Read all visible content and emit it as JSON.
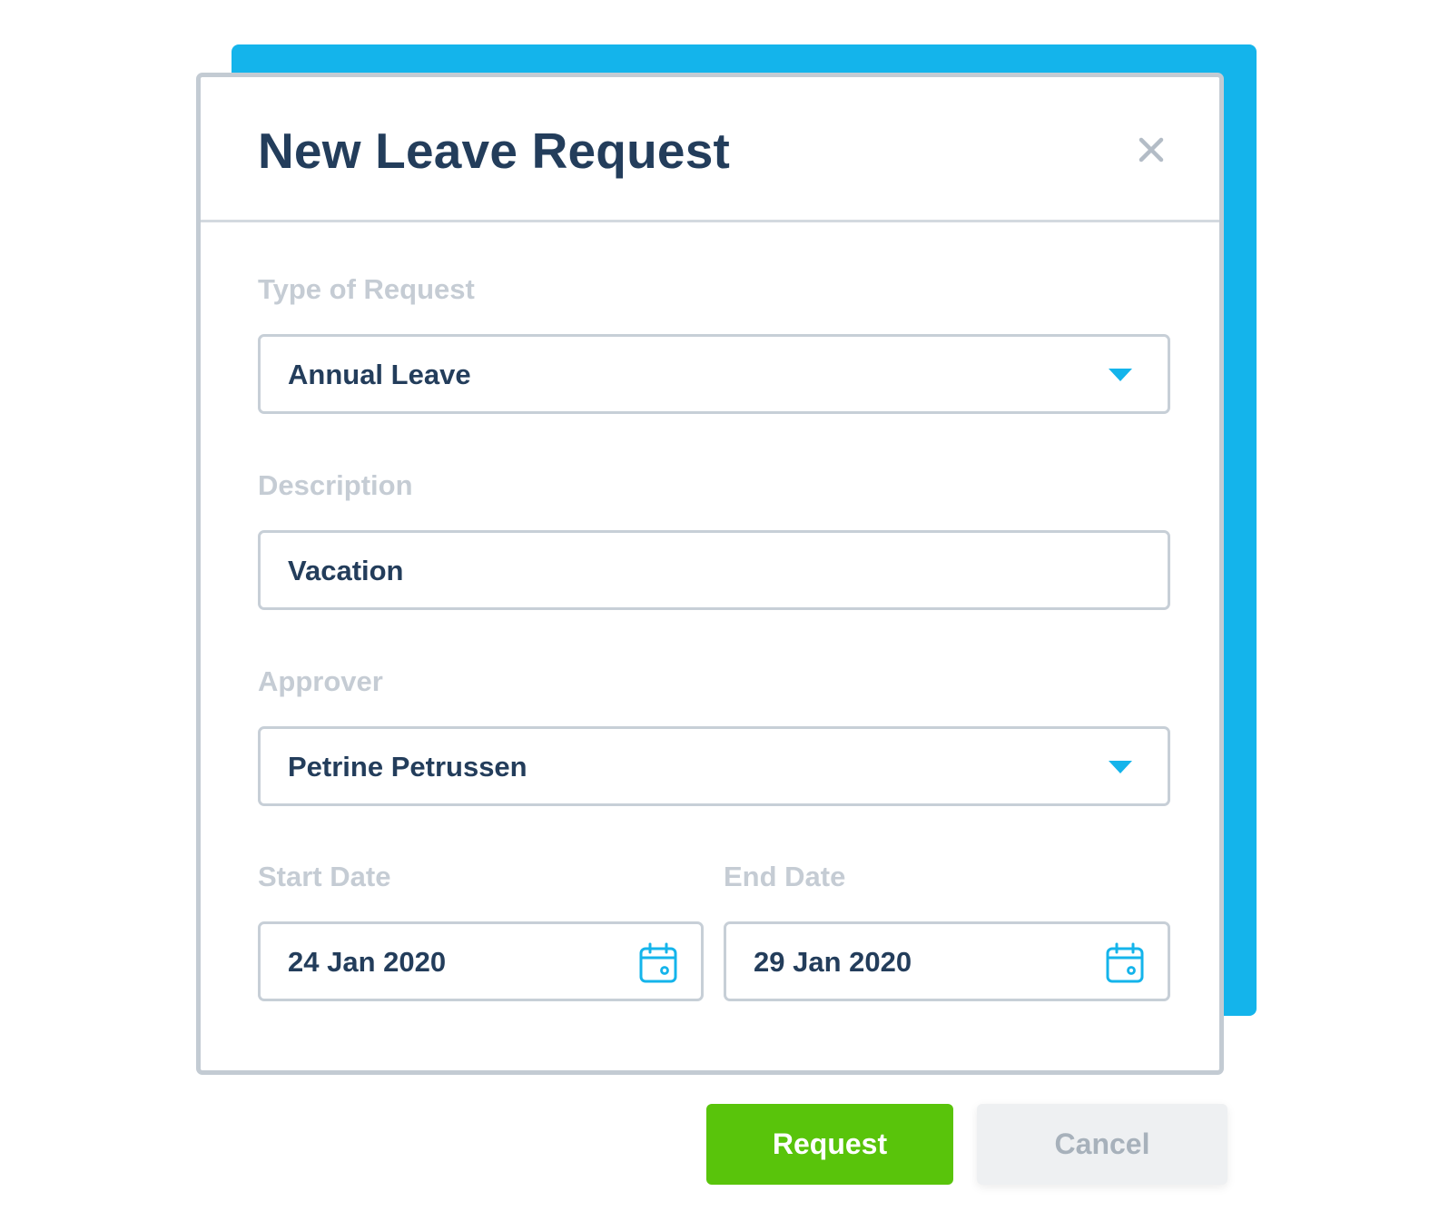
{
  "colors": {
    "accent": "#14b4eb",
    "title_text": "#233d5b",
    "label_text": "#c5ccd4",
    "request_button": "#59c40b",
    "cancel_button": "#eef0f2"
  },
  "modal": {
    "title": "New Leave Request",
    "close_icon": "close-icon"
  },
  "form": {
    "type_of_request": {
      "label": "Type of Request",
      "value": "Annual Leave",
      "icon": "chevron-down-icon"
    },
    "description": {
      "label": "Description",
      "value": "Vacation"
    },
    "approver": {
      "label": "Approver",
      "value": "Petrine Petrussen",
      "icon": "chevron-down-icon"
    },
    "start_date": {
      "label": "Start Date",
      "value": "24 Jan 2020",
      "icon": "calendar-icon"
    },
    "end_date": {
      "label": "End Date",
      "value": "29 Jan 2020",
      "icon": "calendar-icon"
    }
  },
  "actions": {
    "request_label": "Request",
    "cancel_label": "Cancel"
  }
}
